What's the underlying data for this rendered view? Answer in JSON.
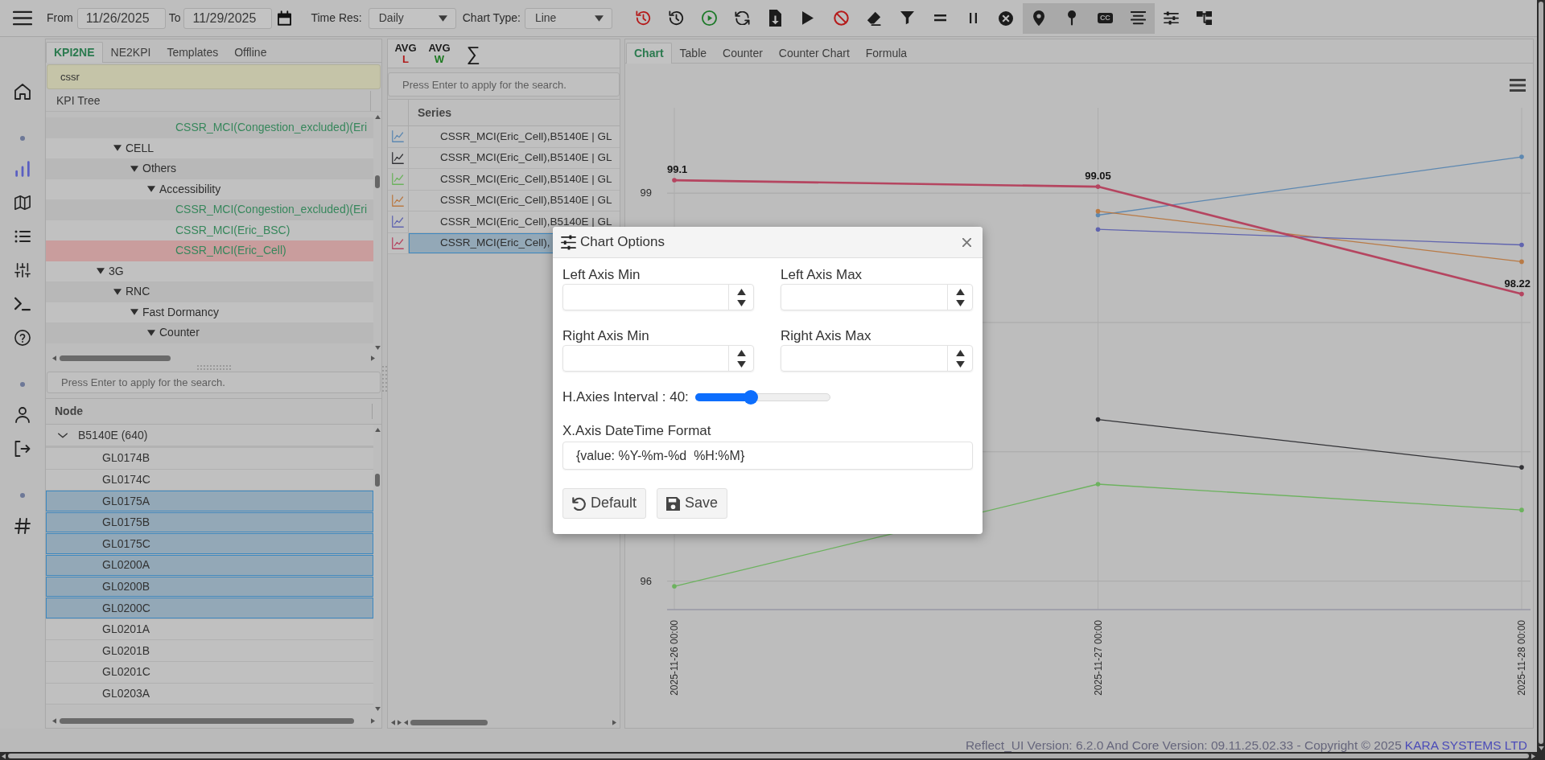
{
  "toolbar": {
    "from_label": "From",
    "from_value": "11/26/2025",
    "to_label": "To",
    "to_value": "11/29/2025",
    "time_res_label": "Time Res:",
    "time_res_value": "Daily",
    "chart_type_label": "Chart Type:",
    "chart_type_value": "Line",
    "tool_buttons": [
      {
        "pressed": false
      },
      {
        "pressed": false
      },
      {
        "pressed": false
      },
      {
        "pressed": false
      },
      {
        "pressed": false
      },
      {
        "pressed": false
      },
      {
        "pressed": false
      },
      {
        "pressed": false
      },
      {
        "pressed": false
      },
      {
        "pressed": false
      },
      {
        "pressed": false
      },
      {
        "pressed": false
      },
      {
        "pressed": true
      },
      {
        "pressed": true
      },
      {
        "pressed": true,
        "label": "CC"
      },
      {
        "pressed": true
      },
      {
        "pressed": false
      },
      {
        "pressed": false
      }
    ]
  },
  "sidebar": {
    "groups": [
      {
        "items": [
          {
            "selected": false
          }
        ]
      },
      {
        "items": [
          {
            "selected": true
          },
          {
            "selected": false
          },
          {
            "selected": false
          },
          {
            "selected": false
          },
          {
            "selected": false
          },
          {
            "selected": false
          }
        ]
      },
      {
        "items": [
          {
            "selected": false
          },
          {
            "selected": false
          }
        ]
      },
      {
        "items": [
          {
            "selected": false
          }
        ]
      }
    ]
  },
  "kpi_panel": {
    "tabs": [
      {
        "label": "KPI2NE",
        "selected": true
      },
      {
        "label": "NE2KPI",
        "selected": false
      },
      {
        "label": "Templates",
        "selected": false
      },
      {
        "label": "Offline",
        "selected": false
      }
    ],
    "search": {
      "value": "cssr"
    },
    "tree_header": "KPI Tree",
    "tree": [
      {
        "children": [
          {
            "children": [
              {
                "children": [
                  {
                    "children": [
                      {
                        "label": "CSSR_MCI(Congestion_excluded)(Eri",
                        "kind": "kpi",
                        "selected": false
                      }
                    ]
                  }
                ]
              }
            ]
          },
          {
            "label": "CELL",
            "kind": "folder",
            "expanded": true,
            "selected": false,
            "children": [
              {
                "label": "Others",
                "kind": "folder",
                "expanded": true,
                "selected": false,
                "children": [
                  {
                    "label": "Accessibility",
                    "kind": "folder",
                    "expanded": true,
                    "selected": false,
                    "children": [
                      {
                        "label": "CSSR_MCI(Congestion_excluded)(Eri",
                        "kind": "kpi",
                        "selected": false
                      },
                      {
                        "label": "CSSR_MCI(Eric_BSC)",
                        "kind": "kpi",
                        "selected": false
                      },
                      {
                        "label": "CSSR_MCI(Eric_Cell)",
                        "kind": "kpi",
                        "selected": true
                      }
                    ]
                  }
                ]
              }
            ]
          }
        ]
      },
      {
        "label": "3G",
        "kind": "folder",
        "expanded": true,
        "selected": false,
        "children": [
          {
            "label": "RNC",
            "kind": "folder",
            "expanded": true,
            "selected": false,
            "children": [
              {
                "label": "Fast Dormancy",
                "kind": "folder",
                "expanded": true,
                "selected": false,
                "children": [
                  {
                    "label": "Counter",
                    "kind": "folder",
                    "expanded": true,
                    "selected": false
                  }
                ]
              }
            ]
          }
        ]
      }
    ]
  },
  "node_panel": {
    "search": {
      "placeholder": "Press Enter to apply for the search."
    },
    "column": "Node",
    "groups": [
      {
        "label": "B5140E (640)",
        "expanded": true,
        "children": [
          {
            "label": "GL0174B",
            "selected": false
          },
          {
            "label": "GL0174C",
            "selected": false
          },
          {
            "label": "GL0175A",
            "selected": true
          },
          {
            "label": "GL0175B",
            "selected": true
          },
          {
            "label": "GL0175C",
            "selected": true
          },
          {
            "label": "GL0200A",
            "selected": true
          },
          {
            "label": "GL0200B",
            "selected": true
          },
          {
            "label": "GL0200C",
            "selected": true
          },
          {
            "label": "GL0201A",
            "selected": false
          },
          {
            "label": "GL0201B",
            "selected": false
          },
          {
            "label": "GL0201C",
            "selected": false
          },
          {
            "label": "GL0203A",
            "selected": false
          }
        ]
      }
    ]
  },
  "series_panel": {
    "tools": [
      {
        "text": "AVG",
        "sub": "L",
        "color": "#b01c1c"
      },
      {
        "text": "AVG",
        "sub": "W",
        "color": "#1e7a22"
      },
      {
        "text": "∑"
      }
    ],
    "search": {
      "placeholder": "Press Enter to apply for the search."
    },
    "column": "Series",
    "rows": [
      {
        "text": "CSSR_MCI(Eric_Cell),B5140E | GL",
        "color": "#5d88b1",
        "selected": false
      },
      {
        "text": "CSSR_MCI(Eric_Cell),B5140E | GL",
        "color": "#323236",
        "selected": false
      },
      {
        "text": "CSSR_MCI(Eric_Cell),B5140E | GL",
        "color": "#6cb25e",
        "selected": false
      },
      {
        "text": "CSSR_MCI(Eric_Cell),B5140E | GL",
        "color": "#b97a45",
        "selected": false
      },
      {
        "text": "CSSR_MCI(Eric_Cell),B5140E | GL",
        "color": "#6064af",
        "selected": false
      },
      {
        "text": "CSSR_MCI(Eric_Cell),",
        "color": "#b54560",
        "selected": true
      }
    ]
  },
  "chart_panel": {
    "tabs": [
      {
        "label": "Chart",
        "selected": true
      },
      {
        "label": "Table",
        "selected": false
      },
      {
        "label": "Counter",
        "selected": false
      },
      {
        "label": "Counter Chart",
        "selected": false
      },
      {
        "label": "Formula",
        "selected": false
      }
    ],
    "chart_data": {
      "type": "line",
      "grid": true,
      "x": [
        "2025-11-26 00:00",
        "2025-11-27 00:00",
        "2025-11-28 00:00"
      ],
      "ylim": [
        95.78,
        99.66
      ],
      "yticks": [
        96,
        99
      ],
      "series": [
        {
          "color": "#5d88b1",
          "values": [
            null,
            98.83,
            99.28
          ],
          "data_labels": false
        },
        {
          "color": "#323236",
          "values": [
            null,
            97.25,
            96.88
          ],
          "data_labels": false
        },
        {
          "color": "#6cb25e",
          "values": [
            95.96,
            96.75,
            96.55
          ],
          "data_labels": false
        },
        {
          "color": "#b97a45",
          "values": [
            null,
            98.86,
            98.47
          ],
          "data_labels": false
        },
        {
          "color": "#6064af",
          "values": [
            null,
            98.72,
            98.6
          ],
          "data_labels": false
        },
        {
          "color": "#b54560",
          "values": [
            99.1,
            99.05,
            98.22
          ],
          "data_labels": true
        }
      ]
    }
  },
  "dialog": {
    "title": "Chart Options",
    "fields": [
      {
        "kind": "number",
        "label": "Left Axis Min"
      },
      {
        "kind": "number",
        "label": "Left Axis Max"
      },
      {
        "kind": "number",
        "label": "Right Axis Min"
      },
      {
        "kind": "number",
        "label": "Right Axis Max"
      },
      {
        "kind": "slider",
        "label": "H.Axies Interval : 40:",
        "level": 0.4
      },
      {
        "kind": "text",
        "label": "X.Axis DateTime Format",
        "value": "{value: %Y-%m-%d  %H:%M}"
      }
    ],
    "buttons": [
      {
        "label": "Default"
      },
      {
        "label": "Save"
      }
    ]
  },
  "footer": {
    "text": "Reflect_UI Version: 6.2.0 And Core Version: 09.11.25.02.33 - Copyright © 2025",
    "link": "KARA SYSTEMS LTD"
  }
}
